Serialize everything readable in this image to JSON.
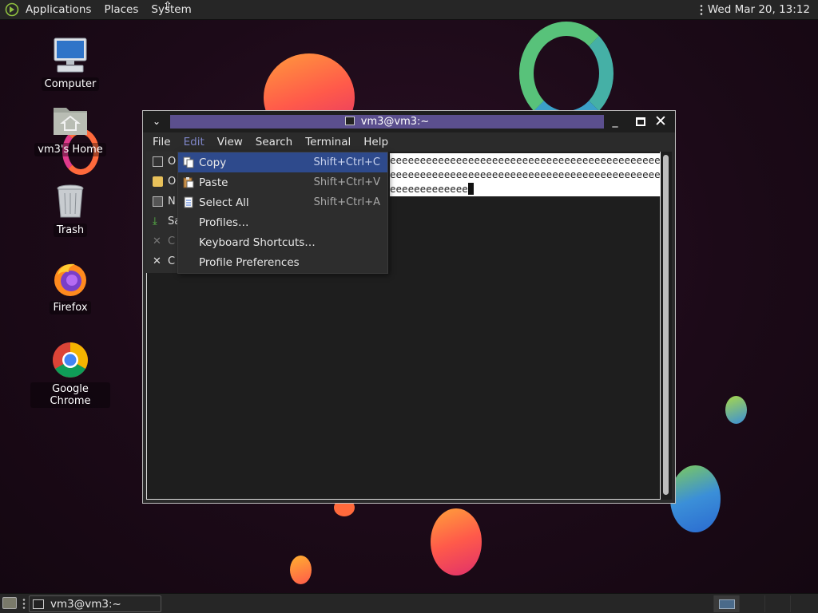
{
  "top_panel": {
    "menus": [
      "Applications",
      "Places",
      "System"
    ],
    "clock": "Wed Mar 20, 13:12"
  },
  "desktop": {
    "icons": [
      {
        "label": "Computer",
        "icon": "computer-icon"
      },
      {
        "label": "vm3's Home",
        "icon": "home-folder-icon"
      },
      {
        "label": "Trash",
        "icon": "trash-icon"
      },
      {
        "label": "Firefox",
        "icon": "firefox-icon"
      },
      {
        "label": "Google Chrome",
        "icon": "chrome-icon"
      }
    ]
  },
  "terminal": {
    "title": "vm3@vm3:~",
    "menubar": [
      "File",
      "Edit",
      "View",
      "Search",
      "Terminal",
      "Help"
    ],
    "active_menu": "Edit",
    "lines": [
      "eeeeeeeeeeeeeeeeeeeeeeeeeeeeeeeeeeeeeeeeeeeeee",
      "eeeeeeeeeeeeeeeeeeeeeeeeeeeeeeeeeeeeeeeeeeeeee",
      "eeeeeeeeeeeee"
    ]
  },
  "file_menu": {
    "items": [
      "O",
      "O",
      "N",
      "Sa",
      "C",
      "C"
    ]
  },
  "edit_menu": {
    "items": [
      {
        "label": "Copy",
        "accel": "Shift+Ctrl+C",
        "highlighted": true
      },
      {
        "label": "Paste",
        "accel": "Shift+Ctrl+V"
      },
      {
        "label": "Select All",
        "accel": "Shift+Ctrl+A"
      },
      {
        "label": "Profiles…",
        "accel": ""
      },
      {
        "label": "Keyboard Shortcuts…",
        "accel": ""
      },
      {
        "label": "Profile Preferences",
        "accel": ""
      }
    ]
  },
  "bottom_panel": {
    "task": "vm3@vm3:~"
  },
  "colors": {
    "menu_highlight": "#2e4a8c",
    "title_bar": "#5b4f8e",
    "active_menu_text": "#7f86c8"
  }
}
